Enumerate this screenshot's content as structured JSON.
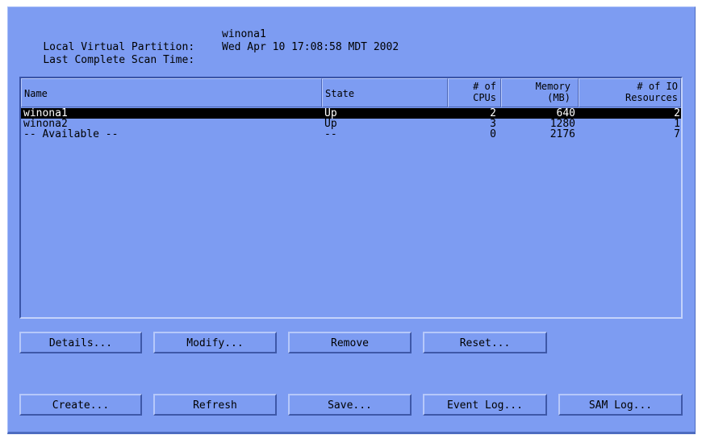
{
  "info": {
    "partition_label": "Local Virtual Partition:",
    "partition_value": "winona1",
    "scan_label": "Last Complete Scan Time:",
    "scan_value": "Wed Apr 10 17:08:58 MDT 2002"
  },
  "table": {
    "columns": {
      "name": "Name",
      "state": "State",
      "cpus_line1": "# of",
      "cpus_line2": "CPUs",
      "memory_line1": "Memory",
      "memory_line2": "(MB)",
      "io_line1": "# of IO",
      "io_line2": "Resources"
    },
    "rows": [
      {
        "name": "winona1",
        "state": "Up",
        "cpus": "2",
        "memory": "640",
        "io": "2",
        "selected": true
      },
      {
        "name": "winona2",
        "state": "Up",
        "cpus": "3",
        "memory": "1280",
        "io": "1",
        "selected": false
      },
      {
        "name": "-- Available --",
        "state": "--",
        "cpus": "0",
        "memory": "2176",
        "io": "7",
        "selected": false
      }
    ]
  },
  "buttons": {
    "details": "Details...",
    "modify": "Modify...",
    "remove": "Remove",
    "reset": "Reset...",
    "create": "Create...",
    "refresh": "Refresh",
    "save": "Save...",
    "event_log": "Event Log...",
    "sam_log": "SAM Log..."
  },
  "colors": {
    "panel_background": "#7d9cf2",
    "selection_background": "#000000",
    "selection_text": "#ffffff"
  }
}
